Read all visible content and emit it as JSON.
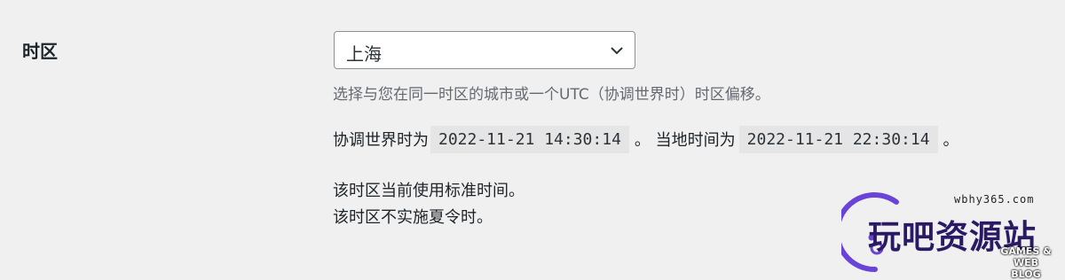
{
  "timezone": {
    "label": "时区",
    "select": {
      "value": "上海"
    },
    "help_text": "选择与您在同一时区的城市或一个UTC（协调世界时）时区偏移。",
    "utc_prefix": "协调世界时为",
    "utc_time": "2022-11-21 14:30:14",
    "local_prefix": "。 当地时间为",
    "local_time": "2022-11-21 22:30:14",
    "end_mark": "。",
    "dst_line1": "该时区当前使用标准时间。",
    "dst_line2": "该时区不实施夏令时。"
  },
  "watermark": {
    "url": "wbhy365.com",
    "name": "玩吧资源站",
    "tagline_top": "GAMES & WEB",
    "tagline_bottom": "BLOG",
    "accent": "#2a1a63",
    "ring_color": "#6a44d8"
  }
}
